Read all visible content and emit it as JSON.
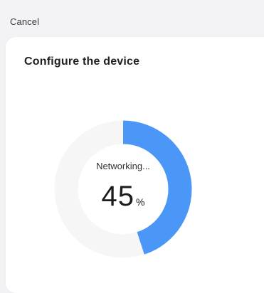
{
  "header": {
    "cancel_label": "Cancel"
  },
  "card": {
    "title": "Configure the device"
  },
  "progress": {
    "status_label": "Networking...",
    "value": "45",
    "unit": "%",
    "fraction": 0.45
  },
  "colors": {
    "accent": "#4a97f7",
    "track": "#f6f6f6",
    "page_background": "#f2f2f4",
    "card_background": "#ffffff"
  }
}
